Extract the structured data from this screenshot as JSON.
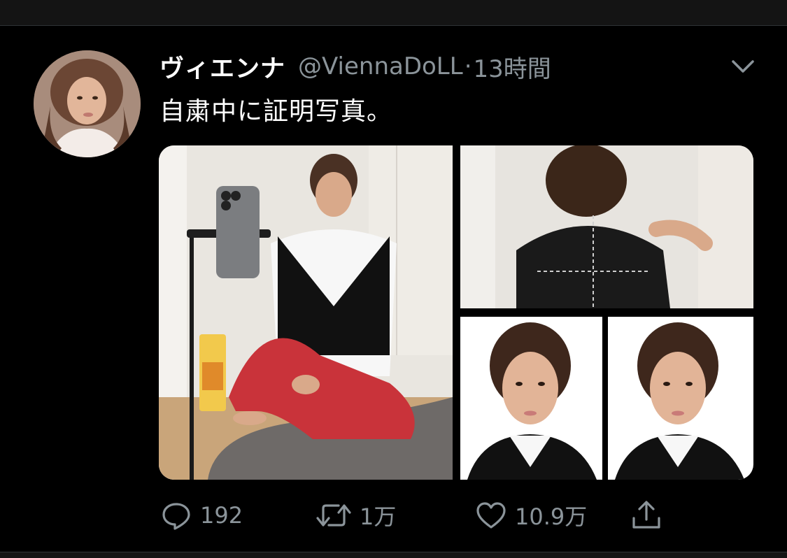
{
  "tweet": {
    "display_name": "ヴィエンナ",
    "handle": "@ViennaDoLL",
    "separator": "·",
    "time": "13時間",
    "text": "自粛中に証明写真。",
    "media_count": 3
  },
  "actions": {
    "reply_count": "192",
    "retweet_count": "1万",
    "like_count": "10.9万"
  },
  "icons": {
    "reply": "speech-bubble-icon",
    "retweet": "retweet-arrows-icon",
    "like": "heart-icon",
    "share": "share-upload-icon",
    "menu": "chevron-down-icon"
  },
  "colors": {
    "background": "#000000",
    "text_primary": "#ffffff",
    "text_secondary": "#8b949a"
  }
}
